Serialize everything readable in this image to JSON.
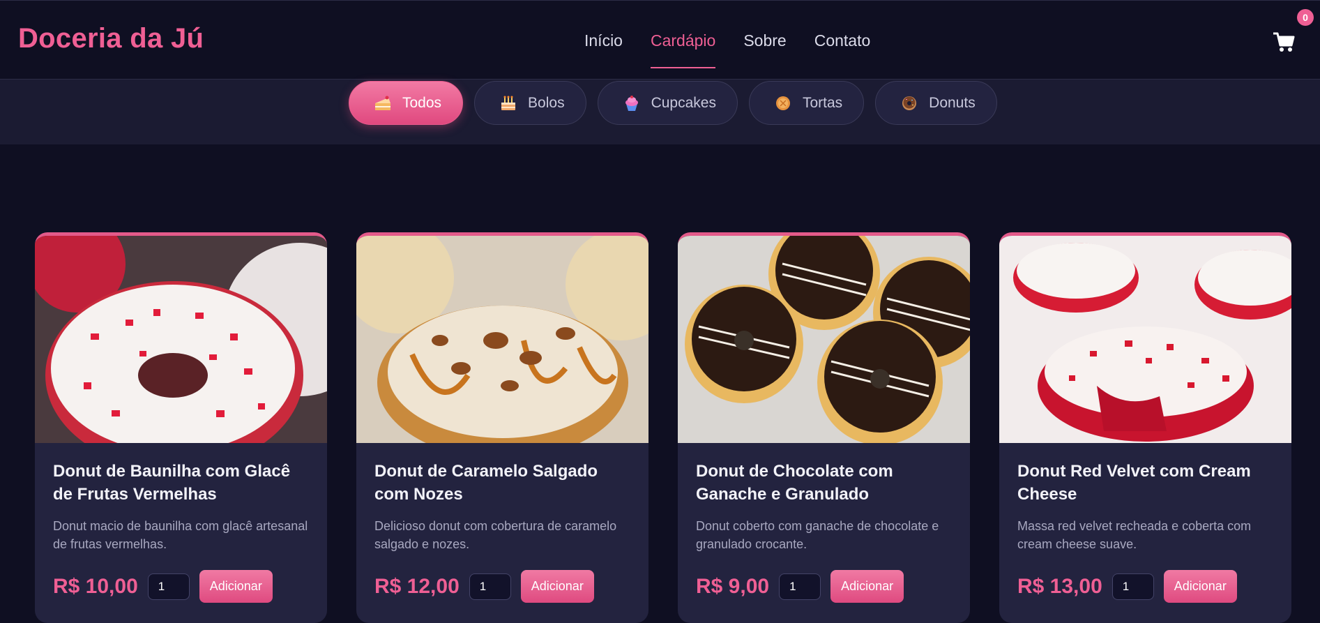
{
  "brand": {
    "name": "Doceria da Jú",
    "accent": "#ef5f94"
  },
  "nav": {
    "items": [
      {
        "label": "Início",
        "active": false
      },
      {
        "label": "Cardápio",
        "active": true
      },
      {
        "label": "Sobre",
        "active": false
      },
      {
        "label": "Contato",
        "active": false
      }
    ]
  },
  "cart": {
    "icon": "cart-icon",
    "count": "0"
  },
  "filters": [
    {
      "label": "Todos",
      "icon": "cake-slice-icon",
      "active": true
    },
    {
      "label": "Bolos",
      "icon": "birthday-cake-icon",
      "active": false
    },
    {
      "label": "Cupcakes",
      "icon": "cupcake-icon",
      "active": false
    },
    {
      "label": "Tortas",
      "icon": "pie-icon",
      "active": false
    },
    {
      "label": "Donuts",
      "icon": "donut-icon",
      "active": false
    }
  ],
  "products": [
    {
      "title": "Donut de Baunilha com Glacê de Frutas Vermelhas",
      "description": "Donut macio de baunilha com glacê artesanal de frutas vermelhas.",
      "price": "R$ 10,00",
      "quantity": "1",
      "button": "Adicionar"
    },
    {
      "title": "Donut de Caramelo Salgado com Nozes",
      "description": "Delicioso donut com cobertura de caramelo salgado e nozes.",
      "price": "R$ 12,00",
      "quantity": "1",
      "button": "Adicionar"
    },
    {
      "title": "Donut de Chocolate com Ganache e Granulado",
      "description": "Donut coberto com ganache de chocolate e granulado crocante.",
      "price": "R$ 9,00",
      "quantity": "1",
      "button": "Adicionar"
    },
    {
      "title": "Donut Red Velvet com Cream Cheese",
      "description": "Massa red velvet recheada e coberta com cream cheese suave.",
      "price": "R$ 13,00",
      "quantity": "1",
      "button": "Adicionar"
    }
  ]
}
